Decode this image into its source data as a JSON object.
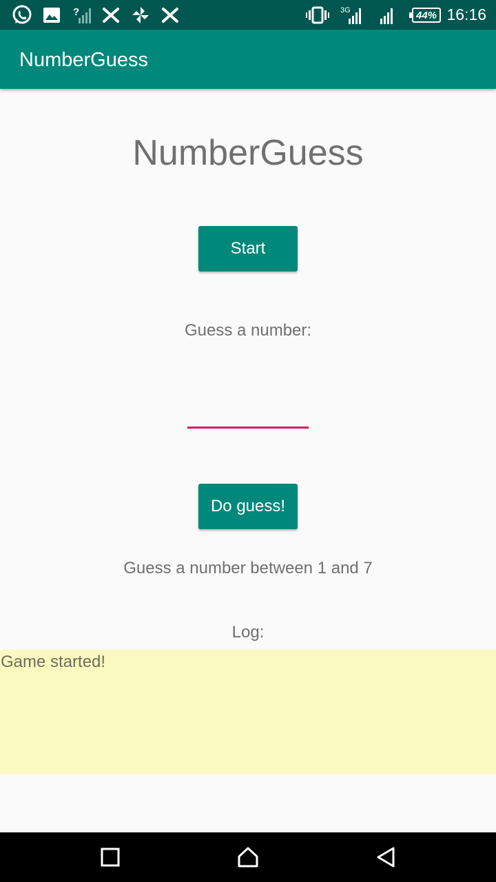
{
  "status_bar": {
    "time": "16:16",
    "battery": "44%",
    "network_type": "3G",
    "icons": [
      "whatsapp-icon",
      "gallery-icon",
      "signal-unknown-icon",
      "x-app-icon",
      "pinwheel-icon",
      "x-app-icon",
      "vibrate-icon",
      "signal-3g-icon",
      "signal-icon",
      "battery-icon"
    ]
  },
  "app_bar": {
    "title": "NumberGuess"
  },
  "main": {
    "heading": "NumberGuess",
    "start_label": "Start",
    "guess_prompt": "Guess a number:",
    "guess_input_value": "",
    "guess_button_label": "Do guess!",
    "hint": "Guess a number between 1 and 7",
    "log_label": "Log:",
    "log_text": "Game started!"
  },
  "colors": {
    "status_bar": "#00574f",
    "app_bar": "#00887a",
    "accent": "#d81b60",
    "log_background": "#fafac0"
  },
  "nav_bar": {
    "buttons": [
      "recents-icon",
      "home-icon",
      "back-icon"
    ]
  }
}
